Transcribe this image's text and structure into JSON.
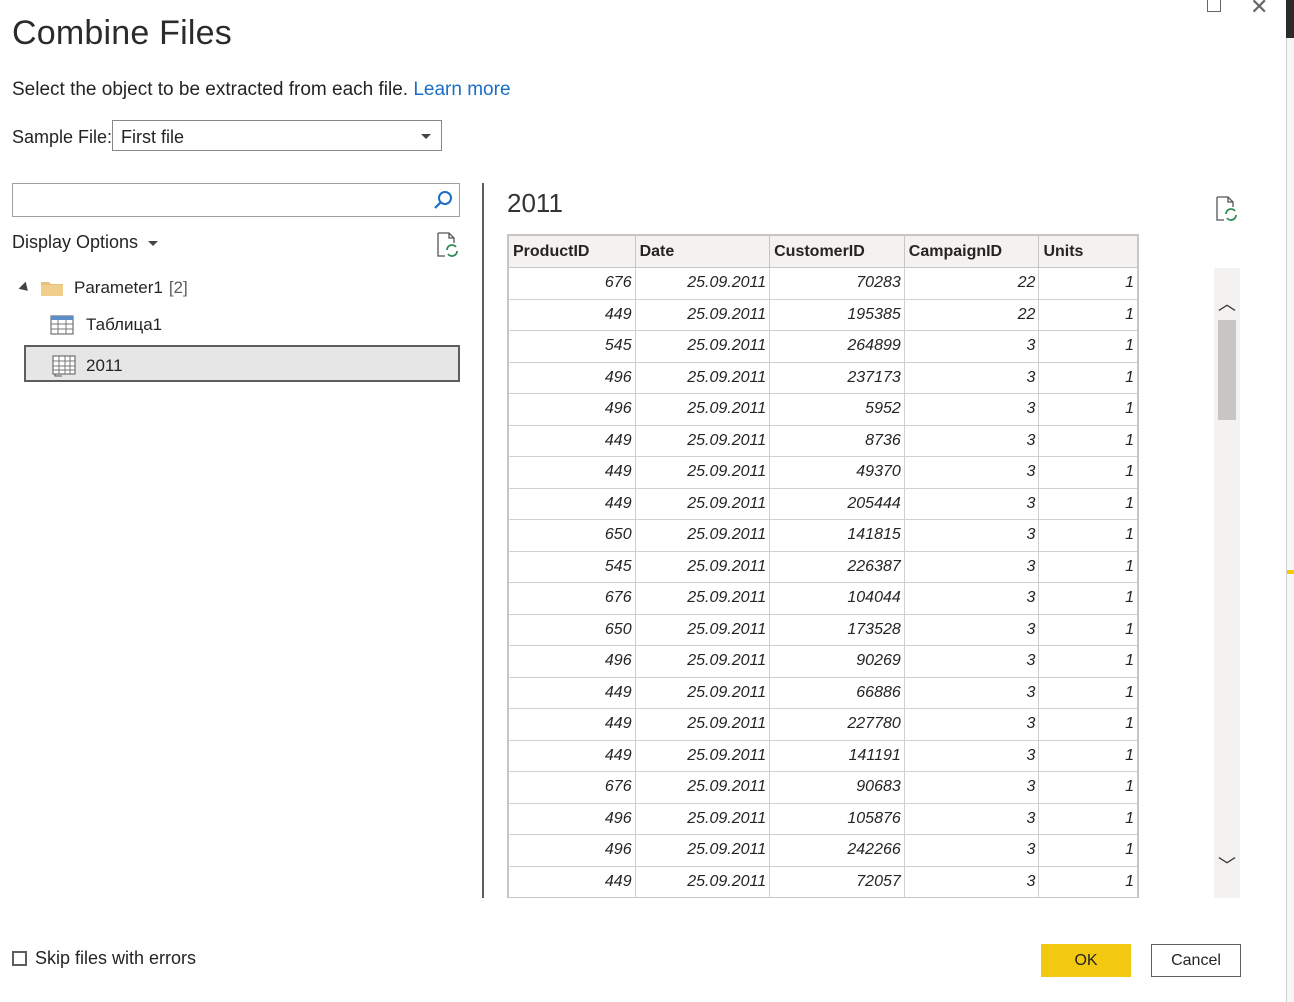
{
  "dialog": {
    "title": "Combine Files",
    "subtitle": "Select the object to be extracted from each file.",
    "learn_more": "Learn more",
    "sample_file_label": "Sample File:",
    "sample_file_value": "First file"
  },
  "navigator": {
    "search_value": "",
    "display_options": "Display Options",
    "tree": {
      "parent": {
        "label": "Parameter1",
        "count": "[2]",
        "icon": "folder-icon"
      },
      "children": [
        {
          "label": "Таблица1",
          "icon": "table-icon"
        },
        {
          "label": "2011",
          "icon": "sheet-icon",
          "selected": true
        }
      ]
    }
  },
  "preview": {
    "title": "2011",
    "columns": [
      "ProductID",
      "Date",
      "CustomerID",
      "CampaignID",
      "Units"
    ],
    "rows": [
      [
        "676",
        "25.09.2011",
        "70283",
        "22",
        "1"
      ],
      [
        "449",
        "25.09.2011",
        "195385",
        "22",
        "1"
      ],
      [
        "545",
        "25.09.2011",
        "264899",
        "3",
        "1"
      ],
      [
        "496",
        "25.09.2011",
        "237173",
        "3",
        "1"
      ],
      [
        "496",
        "25.09.2011",
        "5952",
        "3",
        "1"
      ],
      [
        "449",
        "25.09.2011",
        "8736",
        "3",
        "1"
      ],
      [
        "449",
        "25.09.2011",
        "49370",
        "3",
        "1"
      ],
      [
        "449",
        "25.09.2011",
        "205444",
        "3",
        "1"
      ],
      [
        "650",
        "25.09.2011",
        "141815",
        "3",
        "1"
      ],
      [
        "545",
        "25.09.2011",
        "226387",
        "3",
        "1"
      ],
      [
        "676",
        "25.09.2011",
        "104044",
        "3",
        "1"
      ],
      [
        "650",
        "25.09.2011",
        "173528",
        "3",
        "1"
      ],
      [
        "496",
        "25.09.2011",
        "90269",
        "3",
        "1"
      ],
      [
        "449",
        "25.09.2011",
        "66886",
        "3",
        "1"
      ],
      [
        "449",
        "25.09.2011",
        "227780",
        "3",
        "1"
      ],
      [
        "449",
        "25.09.2011",
        "141191",
        "3",
        "1"
      ],
      [
        "676",
        "25.09.2011",
        "90683",
        "3",
        "1"
      ],
      [
        "496",
        "25.09.2011",
        "105876",
        "3",
        "1"
      ],
      [
        "496",
        "25.09.2011",
        "242266",
        "3",
        "1"
      ],
      [
        "449",
        "25.09.2011",
        "72057",
        "3",
        "1"
      ]
    ]
  },
  "footer": {
    "skip_label": "Skip files with errors",
    "skip_checked": false,
    "ok_label": "OK",
    "cancel_label": "Cancel"
  },
  "colors": {
    "accent": "#f2c811",
    "link": "#1a6fc4",
    "selected_bg": "#e6e6e6"
  }
}
